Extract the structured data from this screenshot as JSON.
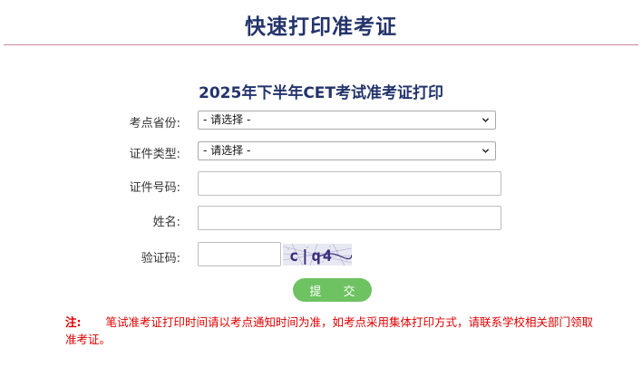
{
  "header": {
    "title": "快速打印准考证"
  },
  "form": {
    "title": "2025年下半年CET考试准考证打印",
    "province": {
      "label": "考点省份:",
      "selected": "- 请选择 -"
    },
    "id_type": {
      "label": "证件类型:",
      "selected": "- 请选择 -"
    },
    "id_number": {
      "label": "证件号码:",
      "value": ""
    },
    "name": {
      "label": "姓名:",
      "value": ""
    },
    "captcha": {
      "label": "验证码:",
      "value": "",
      "image_text": "c|q4"
    },
    "submit_label": "提 交"
  },
  "note": {
    "label": "注:",
    "text": "笔试准考证打印时间请以考点通知时间为准，如考点采用集体打印方式，请联系学校相关部门领取准考证。"
  },
  "colors": {
    "title": "#23336b",
    "divider": "#c98a9c",
    "button": "#6ec261",
    "note": "#e00000"
  }
}
